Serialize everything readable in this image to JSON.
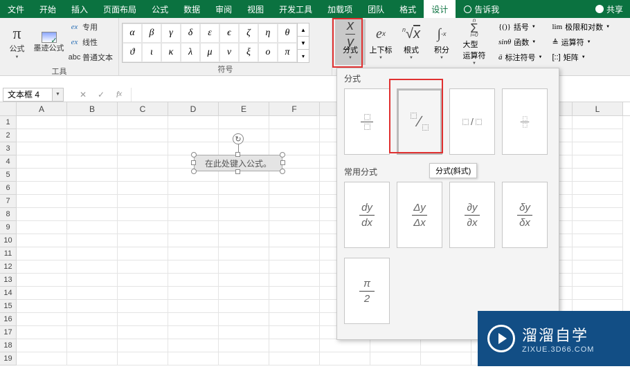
{
  "tabs": {
    "file": "文件",
    "home": "开始",
    "insert": "插入",
    "layout": "页面布局",
    "formulas": "公式",
    "data": "数据",
    "review": "审阅",
    "view": "视图",
    "dev": "开发工具",
    "addins": "加载项",
    "team": "团队",
    "format": "格式",
    "design": "设计",
    "tellme": "告诉我",
    "share": "共享"
  },
  "ribbon": {
    "tools": {
      "equation": "公式",
      "ink": "墨迹公式",
      "pro": "专用",
      "linear": "线性",
      "normal": "普通文本",
      "group": "工具"
    },
    "symbols": {
      "row1": [
        "α",
        "β",
        "γ",
        "δ",
        "ε",
        "ϵ",
        "ζ",
        "η",
        "θ"
      ],
      "row2": [
        "ϑ",
        "ι",
        "κ",
        "λ",
        "μ",
        "ν",
        "ξ",
        "ο",
        "π"
      ],
      "group": "符号"
    },
    "structures": {
      "fraction": "分式",
      "superscript": "上下标",
      "radical": "根式",
      "integral": "积分",
      "large": "大型",
      "large2": "运算符",
      "bracket": "括号",
      "function": "函数",
      "accent": "标注符号",
      "limit": "极限和对数",
      "operator": "运算符",
      "matrix": "矩阵"
    }
  },
  "namebox": "文本框 4",
  "grid": {
    "cols": [
      "A",
      "B",
      "C",
      "D",
      "E",
      "F",
      "",
      "",
      "",
      "",
      "",
      "L"
    ],
    "rows": 19
  },
  "eq_placeholder": "在此处键入公式。",
  "panel": {
    "title1": "分式",
    "title2": "常用分式",
    "tooltip": "分式(斜式)",
    "common": [
      "dy|dx",
      "Δy|Δx",
      "∂y|∂x",
      "δy|δx",
      "π|2"
    ]
  },
  "logo": {
    "title": "溜溜自学",
    "sub": "ZIXUE.3D66.COM"
  }
}
